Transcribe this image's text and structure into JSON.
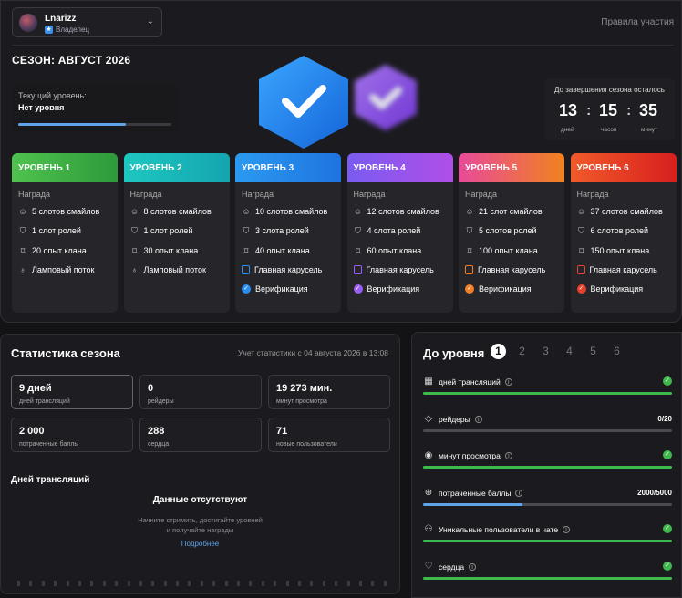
{
  "header": {
    "user_name": "Lnarizz",
    "user_role": "Владелец",
    "rules_link": "Правила участия",
    "season_title": "СЕЗОН: АВГУСТ 2026"
  },
  "current_level": {
    "label": "Текущий уровень:",
    "value": "Нет уровня",
    "progress": 0.7
  },
  "timer": {
    "title": "До завершения сезона осталось",
    "days": "13",
    "hours": "15",
    "minutes": "35",
    "days_label": "дней",
    "hours_label": "часов",
    "minutes_label": "минут"
  },
  "levels": [
    {
      "title": "УРОВЕНЬ 1",
      "color": "#4fc34f",
      "color2": "#2d9a39",
      "reward_label": "Награда",
      "smiles": "5 слотов смайлов",
      "roles": "1 слот ролей",
      "xp": "20 опыт клана",
      "stream": "Ламповый поток"
    },
    {
      "title": "УРОВЕНЬ 2",
      "color": "#1ec7c0",
      "color2": "#14a5b0",
      "reward_label": "Награда",
      "smiles": "8 слотов смайлов",
      "roles": "1 слот ролей",
      "xp": "30 опыт клана",
      "stream": "Ламповый поток"
    },
    {
      "title": "УРОВЕНЬ 3",
      "color": "#2b9af0",
      "color2": "#1e74e0",
      "reward_label": "Награда",
      "smiles": "10 слотов смайлов",
      "roles": "3 слота ролей",
      "xp": "40 опыт клана",
      "carousel": "Главная карусель",
      "verify": "Верификация",
      "verify_color": "#2a8ef0"
    },
    {
      "title": "УРОВЕНЬ 4",
      "color": "#7a5cf0",
      "color2": "#b04ee8",
      "reward_label": "Награда",
      "smiles": "12 слотов смайлов",
      "roles": "4 слота ролей",
      "xp": "60 опыт клана",
      "carousel": "Главная карусель",
      "verify": "Верификация",
      "verify_color": "#9b5cf0"
    },
    {
      "title": "УРОВЕНЬ 5",
      "color": "#e84a9a",
      "color2": "#f0821e",
      "reward_label": "Награда",
      "smiles": "21 слот смайлов",
      "roles": "5 слотов ролей",
      "xp": "100 опыт клана",
      "carousel": "Главная карусель",
      "verify": "Верификация",
      "verify_color": "#f0802a"
    },
    {
      "title": "УРОВЕНЬ 6",
      "color": "#f05a2a",
      "color2": "#d8201e",
      "reward_label": "Награда",
      "smiles": "37 слотов смайлов",
      "roles": "6 слотов ролей",
      "xp": "150 опыт клана",
      "carousel": "Главная карусель",
      "verify": "Верификация",
      "verify_color": "#e8402a"
    }
  ],
  "stats": {
    "title": "Статистика сезона",
    "date": "Учет статистики с 04 августа 2026 в 13:08",
    "cards": [
      {
        "value": "9 дней",
        "label": "дней трансляций"
      },
      {
        "value": "0",
        "label": "рейдеры"
      },
      {
        "value": "19 273 мин.",
        "label": "минут просмотра"
      },
      {
        "value": "2 000",
        "label": "потраченные баллы"
      },
      {
        "value": "288",
        "label": "сердца"
      },
      {
        "value": "71",
        "label": "новые пользователи"
      }
    ],
    "days_title": "Дней трансляций",
    "no_data": "Данные отсутствуют",
    "hint1": "Начните стримить, достигайте уровней",
    "hint2": "и получайте награды",
    "more": "Подробнее"
  },
  "goal": {
    "title": "До уровня",
    "tabs": [
      "1",
      "2",
      "3",
      "4",
      "5",
      "6"
    ],
    "active_tab": "1",
    "rows": [
      {
        "label": "дней трансляций",
        "icon": "calendar-icon",
        "done": true,
        "progress": 1.0,
        "right": ""
      },
      {
        "label": "рейдеры",
        "icon": "diamond-icon",
        "done": false,
        "progress": 0.0,
        "right": "0/20"
      },
      {
        "label": "минут просмотра",
        "icon": "eye-icon",
        "done": true,
        "progress": 1.0,
        "right": ""
      },
      {
        "label": "потраченные баллы",
        "icon": "points-icon",
        "done": false,
        "progress": 0.4,
        "right": "2000/5000"
      },
      {
        "label": "Уникальные пользователи в чате",
        "icon": "user-icon",
        "done": true,
        "progress": 1.0,
        "right": ""
      },
      {
        "label": "сердца",
        "icon": "heart-icon",
        "done": true,
        "progress": 1.0,
        "right": ""
      }
    ]
  }
}
